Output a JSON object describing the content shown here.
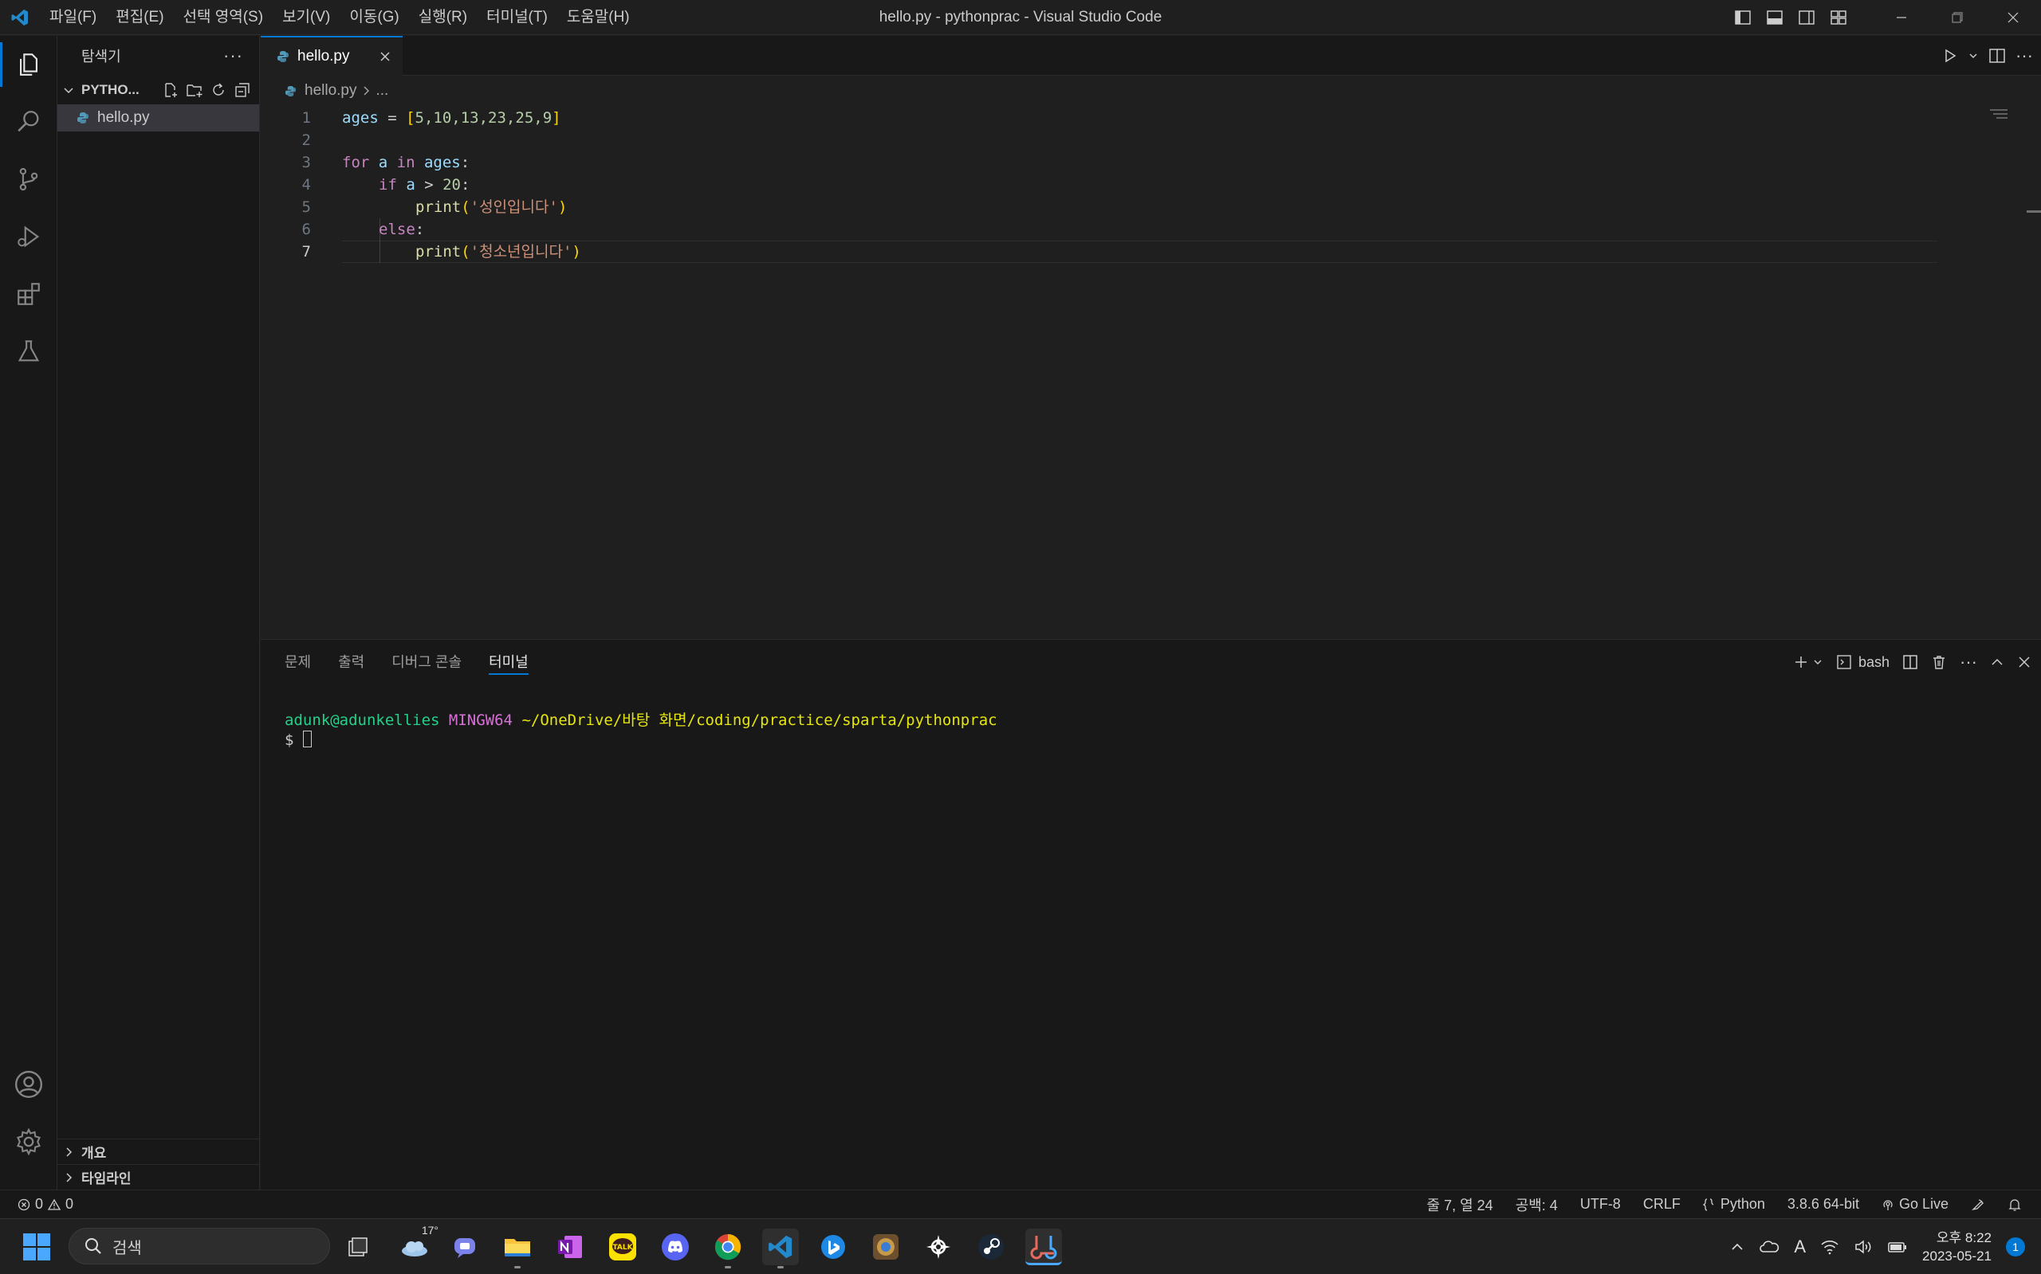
{
  "window": {
    "title": "hello.py - pythonprac - Visual Studio Code"
  },
  "menu": [
    "파일(F)",
    "편집(E)",
    "선택 영역(S)",
    "보기(V)",
    "이동(G)",
    "실행(R)",
    "터미널(T)",
    "도움말(H)"
  ],
  "sidebar": {
    "header": "탐색기",
    "folder_name": "PYTHO...",
    "files": [
      "hello.py"
    ],
    "sections": [
      "개요",
      "타임라인"
    ]
  },
  "tab": {
    "label": "hello.py"
  },
  "breadcrumb": {
    "file": "hello.py",
    "rest": "..."
  },
  "editor": {
    "line_numbers": [
      "1",
      "2",
      "3",
      "4",
      "5",
      "6",
      "7"
    ],
    "line1": {
      "var": "ages",
      "eq": " = ",
      "open": "[",
      "items": "5,10,13,23,25,9",
      "close": "]"
    },
    "line3": {
      "for": "for",
      "a": " a ",
      "in": "in",
      "ages": " ages",
      "colon": ":"
    },
    "line4": {
      "if": "if",
      "rest_a": " a ",
      "op": "> ",
      "num": "20",
      "colon": ":"
    },
    "line5": {
      "func": "print",
      "open": "(",
      "str": "'성인입니다'",
      "close": ")"
    },
    "line6": {
      "else": "else",
      "colon": ":"
    },
    "line7": {
      "func": "print",
      "open": "(",
      "str": "'청소년입니다'",
      "close": ")"
    }
  },
  "panel": {
    "tabs": [
      "문제",
      "출력",
      "디버그 콘솔",
      "터미널"
    ],
    "active_tab": "터미널",
    "shell": "bash",
    "terminal": {
      "user": "adunk@adunkellies",
      "env": "MINGW64",
      "path": "~/OneDrive/바탕 화면/coding/practice/sparta/pythonprac",
      "prompt": "$"
    }
  },
  "statusbar": {
    "errors": "0",
    "warnings": "0",
    "position": "줄 7, 열 24",
    "spaces": "공백: 4",
    "encoding": "UTF-8",
    "eol": "CRLF",
    "language": "Python",
    "interpreter": "3.8.6 64-bit",
    "golive": "Go Live"
  },
  "taskbar": {
    "search_placeholder": "검색",
    "weather": "17°",
    "time": "오후 8:22",
    "date": "2023-05-21",
    "notifications": "1",
    "ime": "A"
  },
  "colors": {
    "accent": "#0078d4",
    "editor_bg": "#1f1f1f",
    "sidebar_bg": "#181818"
  }
}
